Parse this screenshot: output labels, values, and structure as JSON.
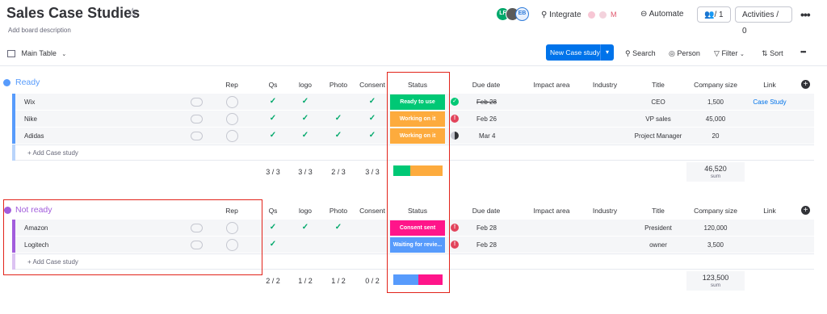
{
  "header": {
    "title": "Sales Case Studies",
    "description": "Add board description",
    "avatars": [
      {
        "initials": "LF",
        "color": "#00a86b"
      },
      {
        "initials": "",
        "color": "#5a5a5a"
      },
      {
        "initials": "EB",
        "color": "#2f7bd9"
      }
    ],
    "integrate_label": "Integrate",
    "automate_label": "Automate",
    "members_count": "/ 1",
    "activities_label": "Activities / 0"
  },
  "toolbar": {
    "main_table_label": "Main Table",
    "new_item_label": "New Case study",
    "search_label": "Search",
    "person_label": "Person",
    "filter_label": "Filter",
    "sort_label": "Sort"
  },
  "columns": [
    "Rep",
    "Qs",
    "logo",
    "Photo",
    "Consent",
    "Status",
    "Due date",
    "Impact area",
    "Industry",
    "Title",
    "Company size",
    "Link"
  ],
  "groups": [
    {
      "name": "Ready",
      "color": "#579bfc",
      "add_label": "+ Add Case study",
      "rows": [
        {
          "name": "Wix",
          "qs": true,
          "logo": true,
          "photo": false,
          "consent": true,
          "status": "Ready to use",
          "status_color": "#00c875",
          "due_date": "Feb 28",
          "due_icon": "done",
          "title": "CEO",
          "company_size": "1,500",
          "link": "Case Study"
        },
        {
          "name": "Nike",
          "qs": true,
          "logo": true,
          "photo": true,
          "consent": true,
          "status": "Working on it",
          "status_color": "#fdab3d",
          "due_date": "Feb 26",
          "due_icon": "overdue",
          "title": "VP sales",
          "company_size": "45,000",
          "link": ""
        },
        {
          "name": "Adidas",
          "qs": true,
          "logo": true,
          "photo": true,
          "consent": true,
          "status": "Working on it",
          "status_color": "#fdab3d",
          "due_date": "Mar 4",
          "due_icon": "pending",
          "title": "Project Manager",
          "company_size": "20",
          "link": ""
        }
      ],
      "summary": {
        "qs": "3 / 3",
        "logo": "3 / 3",
        "photo": "2 / 3",
        "consent": "3 / 3",
        "status_split": [
          0.35,
          0.65
        ],
        "status_split_colors": [
          "#00c875",
          "#fdab3d"
        ],
        "company_size_sum": "46,520",
        "sum_label": "sum"
      }
    },
    {
      "name": "Not ready",
      "color": "#a25ddc",
      "add_label": "+ Add Case study",
      "rows": [
        {
          "name": "Amazon",
          "qs": true,
          "logo": true,
          "photo": true,
          "consent": false,
          "status": "Consent sent",
          "status_color": "#ff158a",
          "due_date": "Feb 28",
          "due_icon": "overdue",
          "title": "President",
          "company_size": "120,000",
          "link": ""
        },
        {
          "name": "Logitech",
          "qs": true,
          "logo": false,
          "photo": false,
          "consent": false,
          "status": "Waiting for revie...",
          "status_color": "#579bfc",
          "due_date": "Feb 28",
          "due_icon": "overdue",
          "title": "owner",
          "company_size": "3,500",
          "link": ""
        }
      ],
      "summary": {
        "qs": "2 / 2",
        "logo": "1 / 2",
        "photo": "1 / 2",
        "consent": "0 / 2",
        "status_split": [
          0.5,
          0.5
        ],
        "status_split_colors": [
          "#579bfc",
          "#ff158a"
        ],
        "company_size_sum": "123,500",
        "sum_label": "sum"
      }
    }
  ],
  "colors": {
    "accent": "#0073ea",
    "highlight": "#e2231a",
    "check": "#00a86b"
  }
}
